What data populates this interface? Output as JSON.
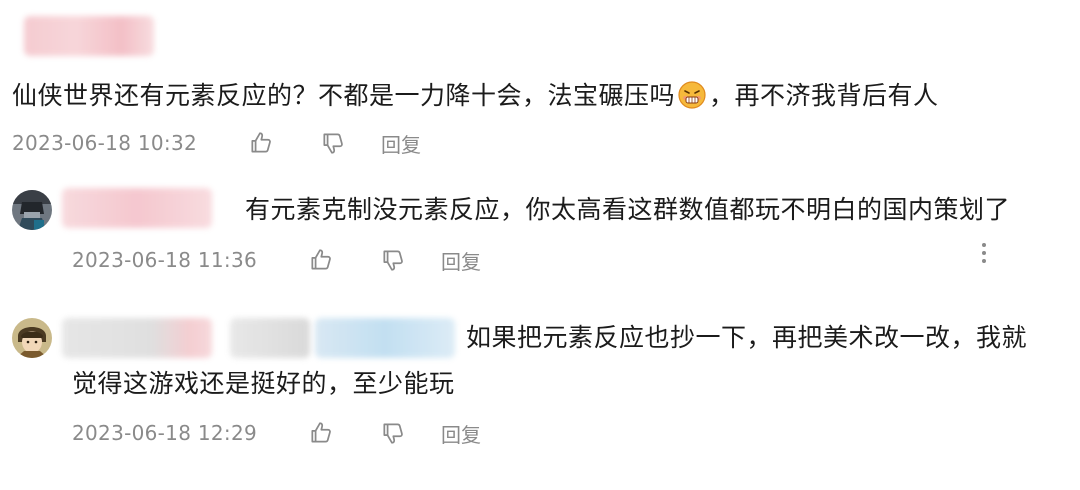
{
  "comments": [
    {
      "text_before_emoji": "仙侠世界还有元素反应的？不都是一力降十会，法宝碾压吗",
      "emoji": "grimace-emoji",
      "text_after_emoji": "，再不济我背后有人",
      "timestamp": "2023-06-18 10:32",
      "reply_label": "回复"
    },
    {
      "text": "有元素克制没元素反应，你太高看这群数值都玩不明白的国内策划了",
      "timestamp": "2023-06-18 11:36",
      "reply_label": "回复",
      "more_icon": "more-vertical-icon"
    },
    {
      "text_line1": "如果把元素反应也抄一下，再把美术改一改，我就",
      "text_line2": "觉得这游戏还是挺好的，至少能玩",
      "timestamp": "2023-06-18 12:29",
      "reply_label": "回复"
    }
  ],
  "icons": {
    "like": "thumbs-up-icon",
    "dislike": "thumbs-down-icon"
  },
  "colors": {
    "text": "#1b1b1b",
    "meta": "#8a8a8a",
    "blur_pink": "#f6c9cf",
    "blur_blue": "#c9e2f3",
    "blur_gray": "#dedede"
  }
}
